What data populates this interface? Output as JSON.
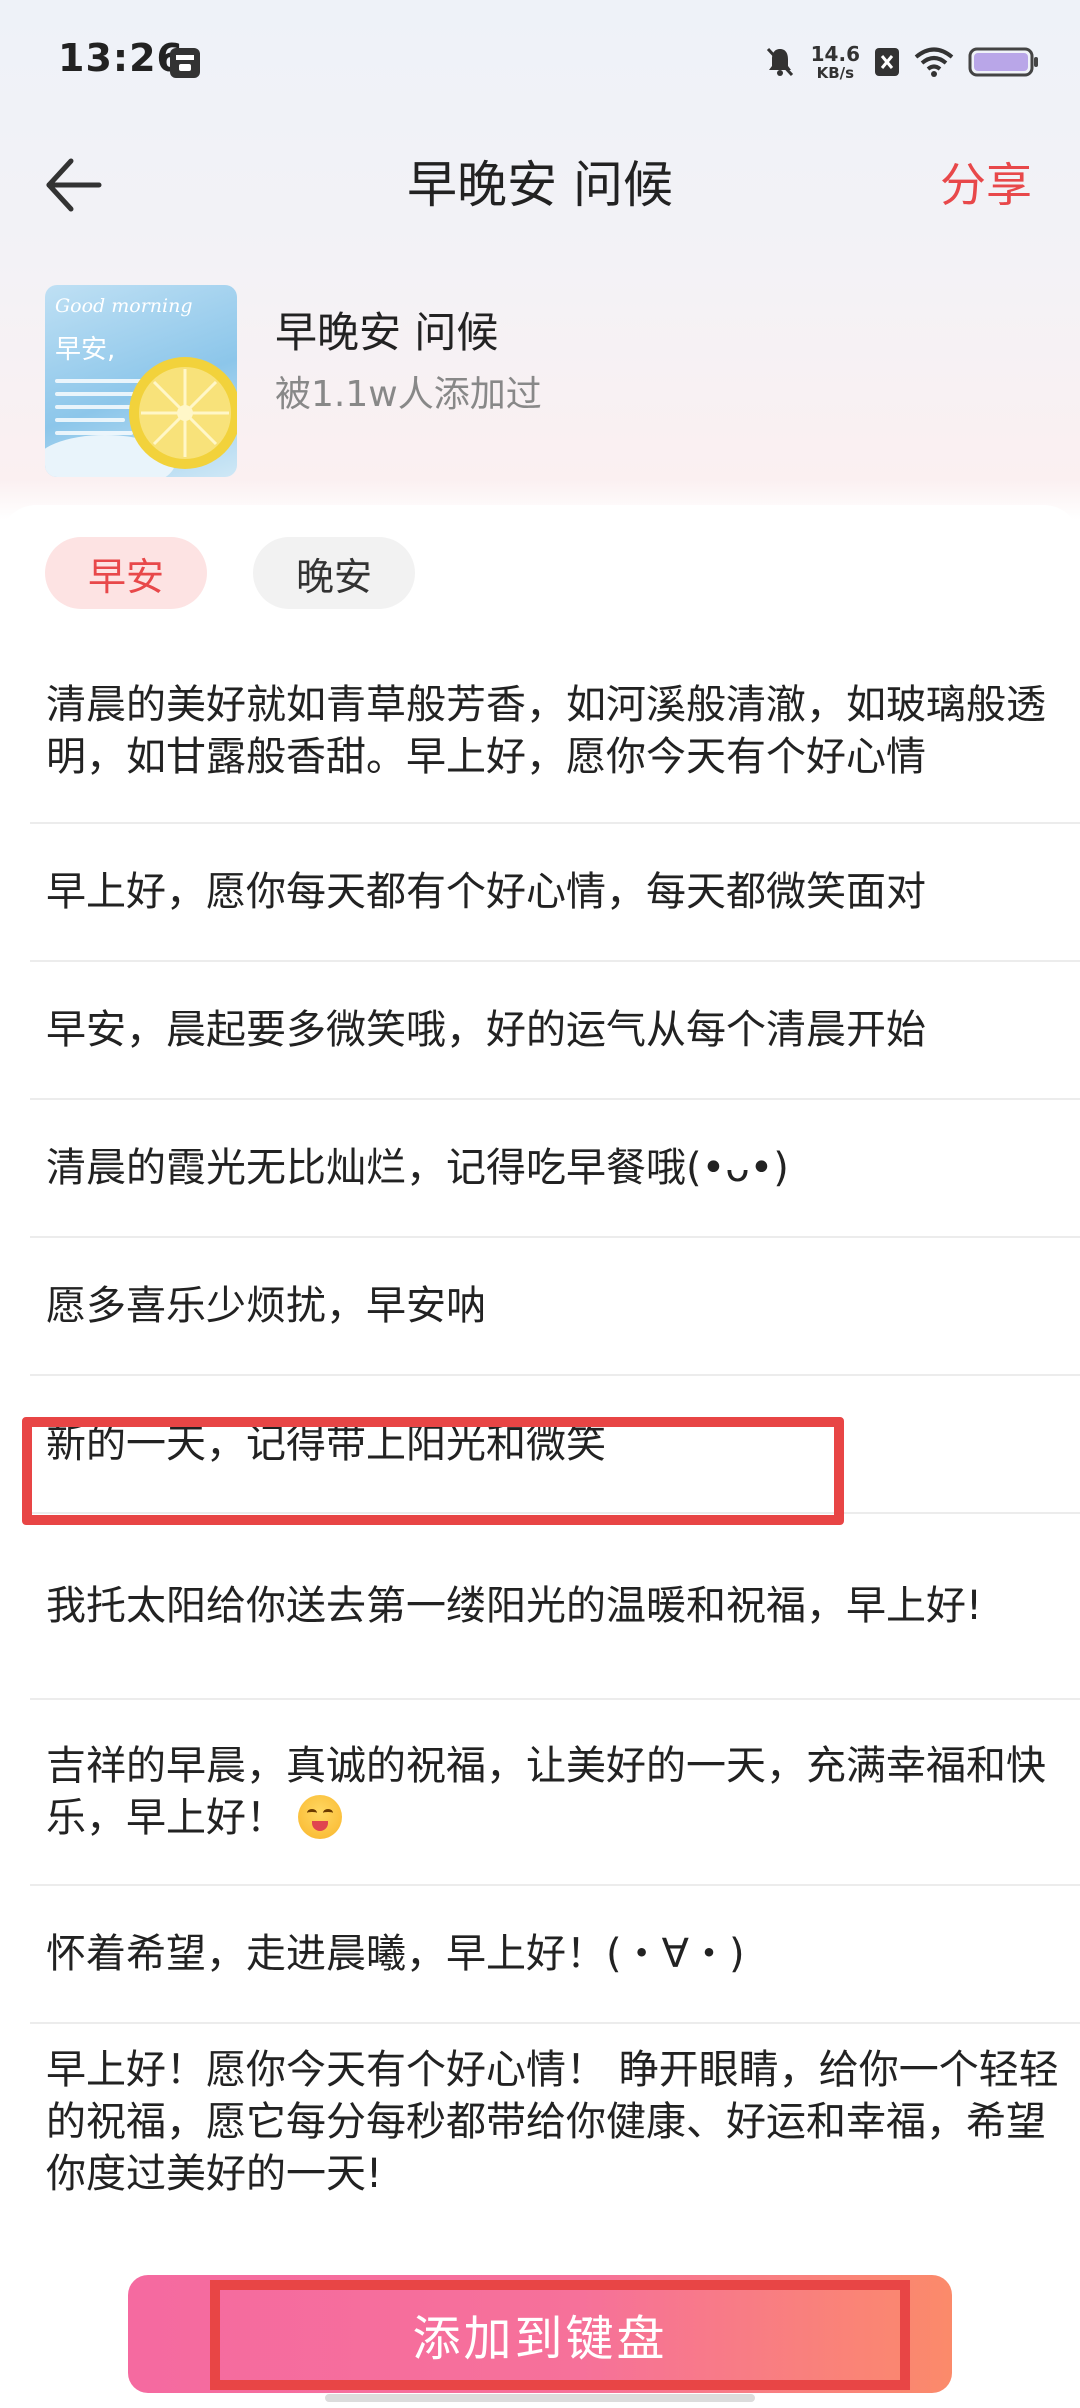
{
  "status_bar": {
    "time": "13:26",
    "net_speed_value": "14.6",
    "net_speed_unit": "KB/s",
    "icons": [
      "app-notification-icon",
      "mute-icon",
      "sim-icon",
      "wifi-icon",
      "battery-icon"
    ]
  },
  "header": {
    "title": "早晚安 问候",
    "share_label": "分享"
  },
  "pack": {
    "cover_line1": "Good morning",
    "cover_line2": "早安,",
    "name": "早晚安 问候",
    "added_count": "被1.1w人添加过"
  },
  "tabs": [
    {
      "label": "早安",
      "active": true
    },
    {
      "label": "晚安",
      "active": false
    }
  ],
  "phrases": [
    "清晨的美好就如青草般芳香，如河溪般清澈，如玻璃般透明，如甘露般香甜。早上好，愿你今天有个好心情",
    "早上好，愿你每天都有个好心情，每天都微笑面对",
    "早安，晨起要多微笑哦，好的运气从每个清晨开始",
    "清晨的霞光无比灿烂，记得吃早餐哦(•ᴗ•)",
    "愿多喜乐少烦扰，早安呐",
    "新的一天，记得带上阳光和微笑",
    "我托太阳给你送去第一缕阳光的温暖和祝福，早上好!",
    "吉祥的早晨，真诚的祝福，让美好的一天，充满幸福和快乐，早上好！",
    "怀着希望，走进晨曦，早上好！(・∀・)",
    "早上好！愿你今天有个好心情！ 睁开眼睛，给你一个轻轻的祝福，愿它每分每秒都带给你健康、好运和幸福，希望你度过美好的一天!"
  ],
  "add_button_label": "添加到键盘",
  "colors": {
    "accent": "#e8484a",
    "button_start": "#f56aa0",
    "button_end": "#fb8a6a"
  }
}
